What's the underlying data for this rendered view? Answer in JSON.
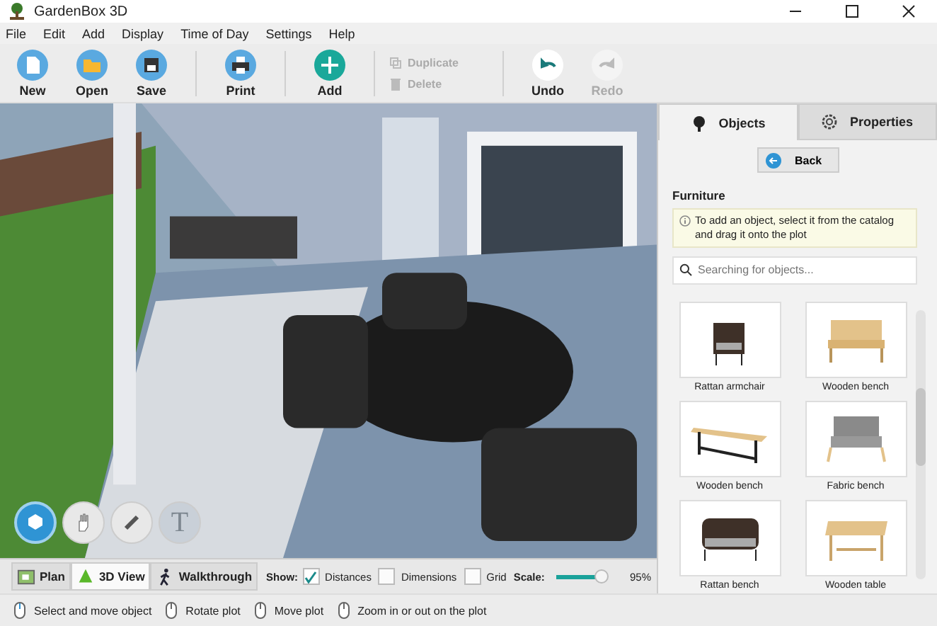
{
  "window": {
    "title": "GardenBox 3D"
  },
  "menu": [
    "File",
    "Edit",
    "Add",
    "Display",
    "Time of Day",
    "Settings",
    "Help"
  ],
  "toolbar": [
    {
      "kind": "big",
      "label": "New",
      "disabled": false
    },
    {
      "kind": "big",
      "label": "Open",
      "disabled": false
    },
    {
      "kind": "big",
      "label": "Save",
      "disabled": false
    },
    {
      "kind": "sep"
    },
    {
      "kind": "big",
      "label": "Print",
      "disabled": false
    },
    {
      "kind": "sep"
    },
    {
      "kind": "big",
      "label": "Add",
      "disabled": false
    },
    {
      "kind": "sep"
    },
    {
      "kind": "pair",
      "items": [
        {
          "label": "Duplicate",
          "disabled": true
        },
        {
          "label": "Delete",
          "disabled": true
        }
      ]
    },
    {
      "kind": "sep"
    },
    {
      "kind": "big",
      "label": "Undo",
      "disabled": false
    },
    {
      "kind": "big",
      "label": "Redo",
      "disabled": true
    }
  ],
  "view_tools": [
    {
      "selected": true,
      "disabled": false
    },
    {
      "selected": false,
      "disabled": false
    },
    {
      "selected": false,
      "disabled": false
    },
    {
      "selected": false,
      "disabled": true,
      "glyph": "T"
    }
  ],
  "view_modes": [
    {
      "label": "Plan",
      "selected": false
    },
    {
      "label": "3D View",
      "selected": true
    },
    {
      "label": "Walkthrough",
      "selected": false
    }
  ],
  "show": {
    "label": "Show:",
    "options": [
      {
        "label": "Distances",
        "checked": true
      },
      {
        "label": "Dimensions",
        "checked": false
      },
      {
        "label": "Grid",
        "checked": false
      }
    ]
  },
  "scale": {
    "label": "Scale:",
    "level": 0.9,
    "reading": "95%"
  },
  "panel": {
    "tabs": [
      {
        "label": "Objects",
        "selected": true
      },
      {
        "label": "Properties",
        "selected": false
      }
    ],
    "back": "Back",
    "heading": "Furniture",
    "hint": "To add an object, select it from the catalog and drag it onto the plot",
    "search": {
      "placeholder": "Searching for objects..."
    },
    "items": [
      {
        "kind": "armchair",
        "label": "Rattan armchair"
      },
      {
        "kind": "bench",
        "label": "Wooden bench"
      },
      {
        "kind": "plainbench",
        "label": "Wooden bench"
      },
      {
        "kind": "sofa",
        "label": "Fabric bench"
      },
      {
        "kind": "rattanbench",
        "label": "Rattan bench"
      },
      {
        "kind": "table",
        "label": "Wooden table"
      }
    ]
  },
  "status": [
    "Select and move object",
    "Rotate plot",
    "Move plot",
    "Zoom in or out on the plot"
  ]
}
